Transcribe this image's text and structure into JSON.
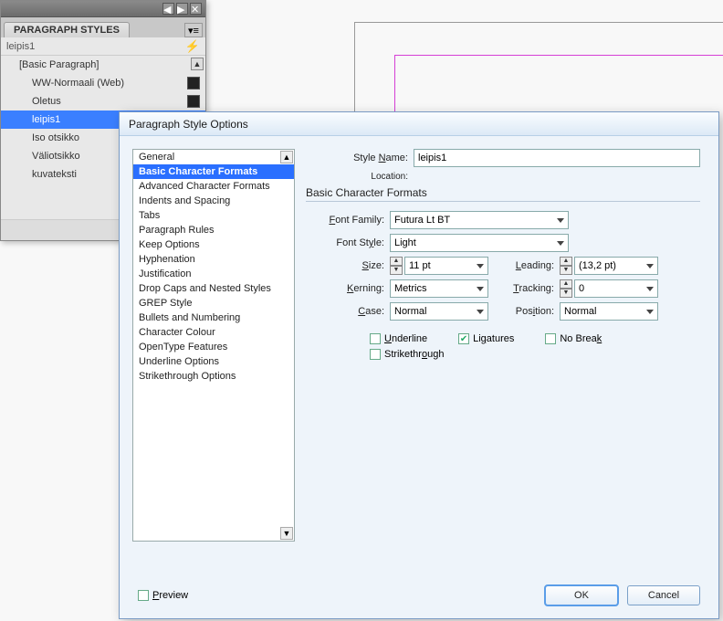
{
  "panel": {
    "title": "PARAGRAPH STYLES",
    "current": "leipis1",
    "items": [
      {
        "label": "[Basic Paragraph]",
        "level": 1,
        "disk": false
      },
      {
        "label": "WW-Normaali (Web)",
        "level": 1,
        "disk": true
      },
      {
        "label": "Oletus",
        "level": 1,
        "disk": true
      },
      {
        "label": "leipis1",
        "level": 1,
        "disk": false,
        "selected": true
      },
      {
        "label": "Iso otsikko",
        "level": 1,
        "disk": false
      },
      {
        "label": "Väliotsikko",
        "level": 1,
        "disk": false
      },
      {
        "label": "kuvateksti",
        "level": 1,
        "disk": false
      }
    ]
  },
  "dialog": {
    "title": "Paragraph Style Options",
    "categories": [
      "General",
      "Basic Character Formats",
      "Advanced Character Formats",
      "Indents and Spacing",
      "Tabs",
      "Paragraph Rules",
      "Keep Options",
      "Hyphenation",
      "Justification",
      "Drop Caps and Nested Styles",
      "GREP Style",
      "Bullets and Numbering",
      "Character Colour",
      "OpenType Features",
      "Underline Options",
      "Strikethrough Options"
    ],
    "selectedCategory": "Basic Character Formats",
    "labels": {
      "styleName": "Style Name:",
      "location": "Location:",
      "section": "Basic Character Formats",
      "fontFamily": "Font Family:",
      "fontStyle": "Font Style:",
      "size": "Size:",
      "leading": "Leading:",
      "kerning": "Kerning:",
      "tracking": "Tracking:",
      "case": "Case:",
      "position": "Position:",
      "underline": "Underline",
      "strikethrough": "Strikethrough",
      "ligatures": "Ligatures",
      "noBreak": "No Break",
      "preview": "Preview",
      "ok": "OK",
      "cancel": "Cancel"
    },
    "values": {
      "styleName": "leipis1",
      "location": "",
      "fontFamily": "Futura Lt BT",
      "fontStyle": "Light",
      "size": "11 pt",
      "leading": "(13,2 pt)",
      "kerning": "Metrics",
      "tracking": "0",
      "case": "Normal",
      "position": "Normal",
      "underline": false,
      "strikethrough": false,
      "ligatures": true,
      "noBreak": false,
      "preview": false
    }
  }
}
